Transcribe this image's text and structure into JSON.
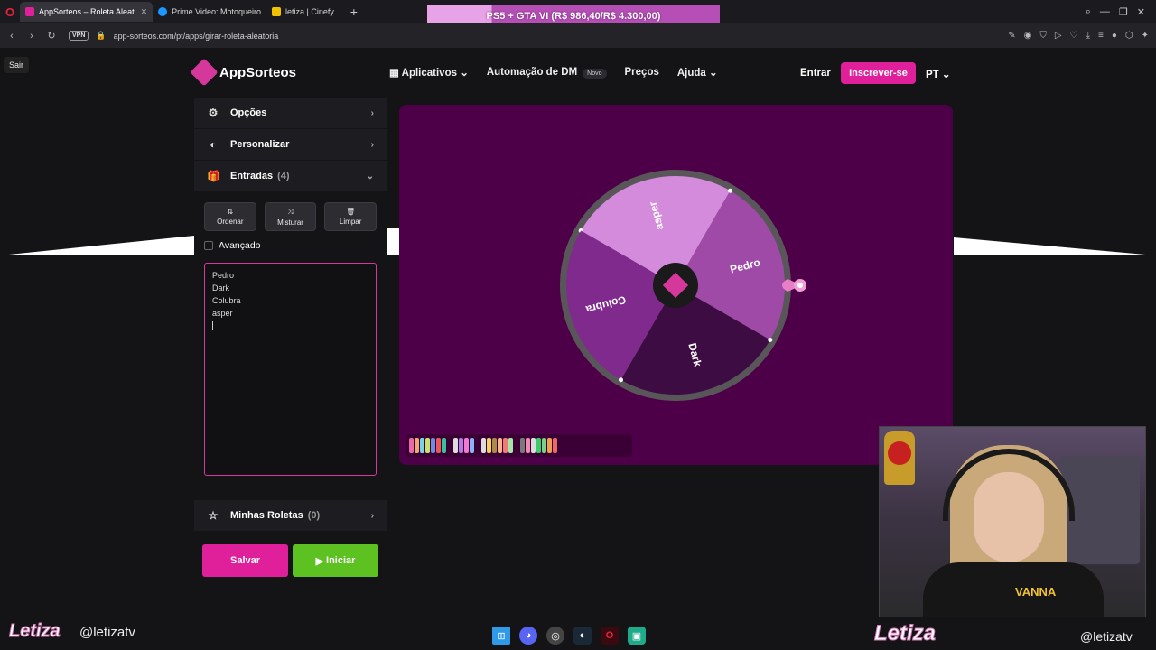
{
  "browser": {
    "tabs": [
      {
        "title": "AppSorteos – Roleta Aleat",
        "active": true,
        "color": "#e0209b"
      },
      {
        "title": "Prime Video: Motoqueiro",
        "active": false,
        "color": "#1a98ff"
      },
      {
        "title": "letiza | Cinefy",
        "active": false,
        "color": "#f2c200"
      }
    ],
    "new_tab": "+",
    "url": "app-sorteos.com/pt/apps/girar-roleta-aleatoria",
    "vpn": "VPN"
  },
  "overlay_banner": {
    "text": "PS5 + GTA VI (R$ 986,40/R$ 4.300,00)",
    "progress_fraction": 0.229
  },
  "sair": "Sair",
  "header": {
    "logo": "AppSorteos",
    "nav": [
      {
        "label": "Aplicativos"
      },
      {
        "label": "Automação de DM",
        "badge": "Novo"
      },
      {
        "label": "Preços"
      },
      {
        "label": "Ajuda"
      }
    ],
    "login": "Entrar",
    "signup": "Inscrever-se",
    "lang": "PT"
  },
  "sidebar": {
    "options": "Opções",
    "customize": "Personalizar",
    "entries": "Entradas",
    "entries_count": "(4)",
    "sort": "Ordenar",
    "shuffle": "Misturar",
    "clear": "Limpar",
    "advanced": "Avançado",
    "entry_lines": [
      "Pedro",
      "Dark",
      "Colubra",
      "asper"
    ],
    "my_wheels": "Minhas Roletas",
    "my_wheels_count": "(0)",
    "save": "Salvar",
    "start": "Iniciar"
  },
  "wheel": {
    "segments": [
      {
        "label": "asper",
        "color": "#d58bdb"
      },
      {
        "label": "Pedro",
        "color": "#a04aa8"
      },
      {
        "label": "Dark",
        "color": "#3d0c43"
      },
      {
        "label": "Colubra",
        "color": "#7f2a8c"
      }
    ],
    "rim_color": "#595659",
    "panel_color": "#4d0047"
  },
  "streamer": {
    "name": "Letiza",
    "handle": "@letizatv",
    "shirt_text": "VANNA"
  }
}
